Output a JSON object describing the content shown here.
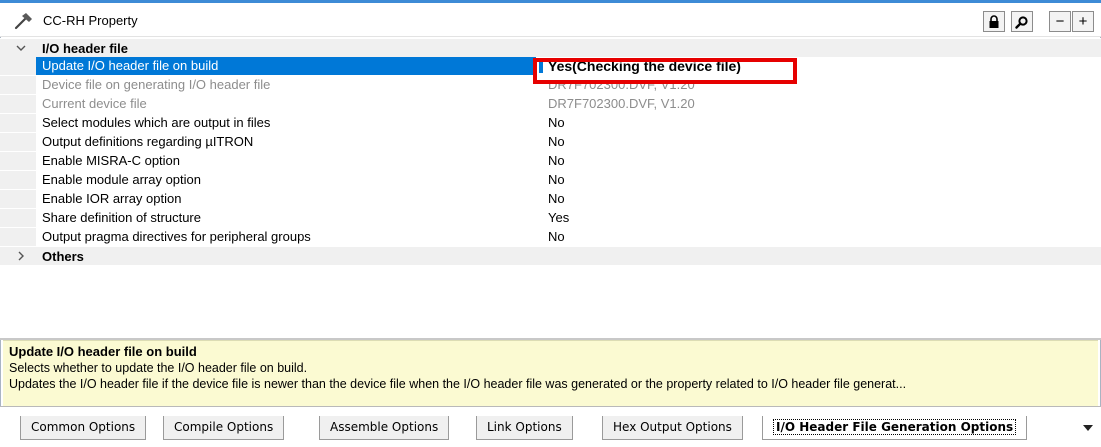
{
  "title": "CC-RH Property",
  "toolbar": {
    "lock_icon": "lock-icon",
    "search_icon": "search-icon",
    "collapse_label": "−",
    "expand_label": "+"
  },
  "categories": [
    {
      "label": "I/O header file",
      "expanded": true,
      "properties": [
        {
          "name": "Update I/O header file on build",
          "value": "Yes(Checking the device file)",
          "selected": true,
          "disabled": false
        },
        {
          "name": "Device file on generating I/O header file",
          "value": "DR7F702300.DVF, V1.20",
          "selected": false,
          "disabled": true
        },
        {
          "name": "Current device file",
          "value": "DR7F702300.DVF, V1.20",
          "selected": false,
          "disabled": true
        },
        {
          "name": "Select modules which are output in files",
          "value": "No",
          "selected": false,
          "disabled": false
        },
        {
          "name": "Output definitions regarding µITRON",
          "value": "No",
          "selected": false,
          "disabled": false
        },
        {
          "name": "Enable MISRA-C option",
          "value": "No",
          "selected": false,
          "disabled": false
        },
        {
          "name": "Enable module array option",
          "value": "No",
          "selected": false,
          "disabled": false
        },
        {
          "name": "Enable IOR array option",
          "value": "No",
          "selected": false,
          "disabled": false
        },
        {
          "name": "Share definition of structure",
          "value": "Yes",
          "selected": false,
          "disabled": false
        },
        {
          "name": "Output pragma directives for peripheral groups",
          "value": "No",
          "selected": false,
          "disabled": false
        }
      ]
    },
    {
      "label": "Others",
      "expanded": false,
      "properties": []
    }
  ],
  "description": {
    "title": "Update I/O header file on build",
    "line1": "Selects whether to update the I/O header file on build.",
    "line2": "Updates the I/O header file if the device file is newer than the device file when the I/O header file was generated or the property related to I/O header file generat..."
  },
  "tabs": [
    {
      "label": "Common Options",
      "active": false
    },
    {
      "label": "Compile Options",
      "active": false
    },
    {
      "label": "Assemble Options",
      "active": false
    },
    {
      "label": "Link Options",
      "active": false
    },
    {
      "label": "Hex Output Options",
      "active": false
    },
    {
      "label": "I/O Header File Generation Options",
      "active": true
    }
  ],
  "colors": {
    "selection": "#0078d7",
    "highlight_box": "#e60000",
    "description_bg": "#fbfad2",
    "category_bg": "#f0f0f0"
  }
}
